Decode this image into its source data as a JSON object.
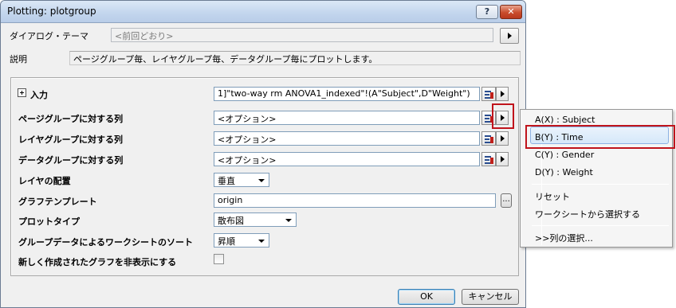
{
  "window": {
    "title": "Plotting: plotgroup",
    "help_label": "?",
    "close_label": "✕"
  },
  "theme": {
    "label": "ダイアログ・テーマ",
    "value": "<前回どおり>"
  },
  "description": {
    "label": "説明",
    "text": "ページグループ毎、レイヤグループ毎、データグループ毎にプロットします。"
  },
  "form": {
    "input": {
      "label": "入力",
      "value": "1]\"two-way rm ANOVA1_indexed\"!(A\"Subject\",D\"Weight\")"
    },
    "page_group": {
      "label": "ページグループに対する列",
      "value": "<オプション>"
    },
    "layer_group": {
      "label": "レイヤグループに対する列",
      "value": "<オプション>"
    },
    "data_group": {
      "label": "データグループに対する列",
      "value": "<オプション>"
    },
    "layer_arrange": {
      "label": "レイヤの配置",
      "value": "垂直"
    },
    "graph_template": {
      "label": "グラフテンプレート",
      "value": "origin",
      "browse_label": "..."
    },
    "plot_type": {
      "label": "プロットタイプ",
      "value": "散布図"
    },
    "sort": {
      "label": "グループデータによるワークシートのソート",
      "value": "昇順"
    },
    "hide_new": {
      "label": "新しく作成されたグラフを非表示にする",
      "checked": false
    }
  },
  "buttons": {
    "ok": "OK",
    "cancel": "キャンセル"
  },
  "menu": {
    "items": [
      "A(X) : Subject",
      "B(Y) : Time",
      "C(Y) : Gender",
      "D(Y) : Weight",
      "リセット",
      "ワークシートから選択する",
      ">>列の選択..."
    ],
    "hovered_index": 1
  },
  "colors": {
    "highlight": "#c0141c",
    "titlebar": "#c2d5ed",
    "dialog_bg": "#f0f0f0"
  }
}
